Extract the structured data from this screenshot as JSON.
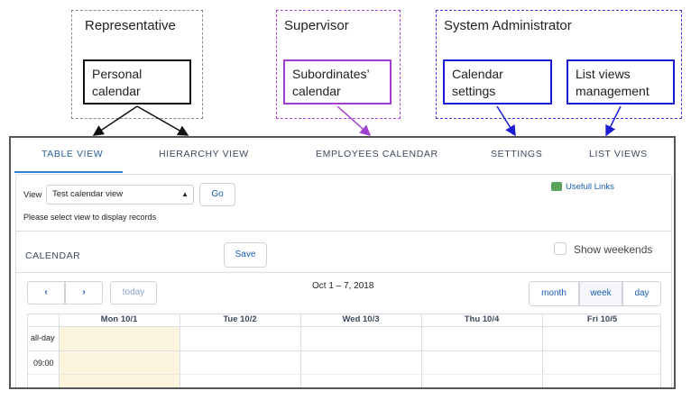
{
  "roles": {
    "representative": {
      "title": "Representative",
      "feature": "Personal calendar"
    },
    "supervisor": {
      "title": "Supervisor",
      "feature": "Subordinates’ calendar"
    },
    "admin": {
      "title": "System Administrator",
      "features": [
        "Calendar settings",
        "List views management"
      ]
    }
  },
  "tabs": [
    "TABLE VIEW",
    "HIERARCHY VIEW",
    "EMPLOYEES CALENDAR",
    "SETTINGS",
    "LIST VIEWS"
  ],
  "view_bar": {
    "view_label": "View",
    "selected_view": "Test calendar view",
    "go_label": "Go",
    "hint": "Please select view to display records",
    "links_label": "Usefull Links"
  },
  "calendar": {
    "heading": "CALENDAR",
    "save_label": "Save",
    "show_weekends_label": "Show weekends",
    "date_range": "Oct 1 – 7, 2018",
    "today_label": "today",
    "month_label": "month",
    "week_label": "week",
    "day_label": "day",
    "days": [
      "Mon 10/1",
      "Tue 10/2",
      "Wed 10/3",
      "Thu 10/4",
      "Fri 10/5"
    ],
    "row_labels": [
      "all-day",
      "09:00"
    ]
  },
  "colors": {
    "highlight_day": "#fdf4de",
    "accent": "#2b82d9"
  }
}
